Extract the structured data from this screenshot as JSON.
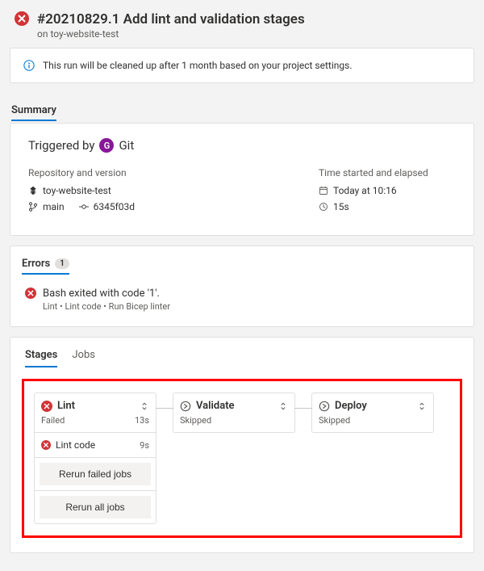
{
  "header": {
    "title": "#20210829.1 Add lint and validation stages",
    "subtitle": "on toy-website-test"
  },
  "banner": {
    "text": "This run will be cleaned up after 1 month based on your project settings."
  },
  "summary": {
    "heading": "Summary",
    "triggered_label": "Triggered by",
    "triggered_avatar": "G",
    "triggered_name": "Git",
    "repo_label": "Repository and version",
    "repo_name": "toy-website-test",
    "branch": "main",
    "commit": "6345f03d",
    "time_label": "Time started and elapsed",
    "started": "Today at 10:16",
    "elapsed": "15s"
  },
  "errors": {
    "heading": "Errors",
    "count": "1",
    "message": "Bash exited with code '1'.",
    "breadcrumb": "Lint • Lint code • Run Bicep linter"
  },
  "stages_tabs": {
    "tab_stages": "Stages",
    "tab_jobs": "Jobs"
  },
  "stages": [
    {
      "name": "Lint",
      "status": "Failed",
      "duration": "13s",
      "status_kind": "failed",
      "jobs": [
        {
          "name": "Lint code",
          "duration": "9s",
          "status_kind": "failed"
        }
      ],
      "rerun_failed": "Rerun failed jobs",
      "rerun_all": "Rerun all jobs"
    },
    {
      "name": "Validate",
      "status": "Skipped",
      "duration": "",
      "status_kind": "skipped"
    },
    {
      "name": "Deploy",
      "status": "Skipped",
      "duration": "",
      "status_kind": "skipped"
    }
  ]
}
